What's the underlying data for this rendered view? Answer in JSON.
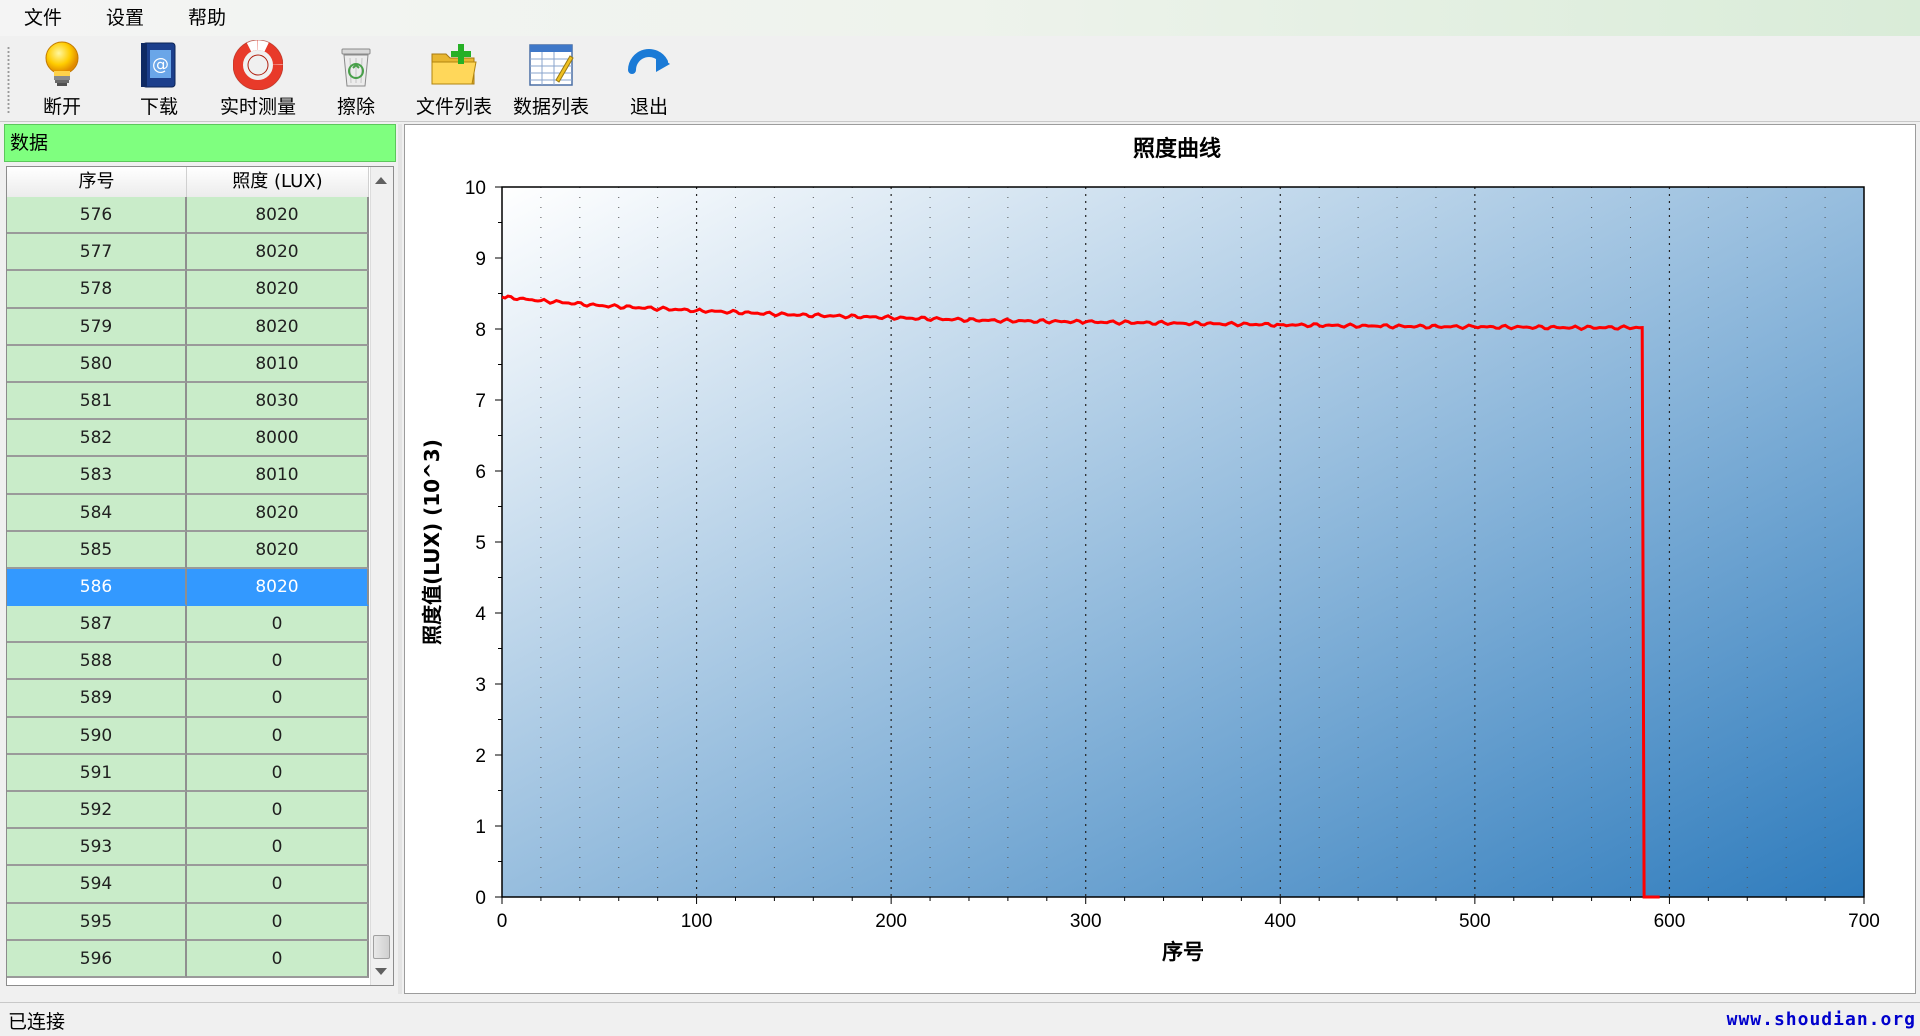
{
  "menu": {
    "items": [
      {
        "label": "文件"
      },
      {
        "label": "设置"
      },
      {
        "label": "帮助"
      }
    ]
  },
  "toolbar": {
    "buttons": [
      {
        "label": "断开",
        "icon": "lightbulb-icon"
      },
      {
        "label": "下载",
        "icon": "address-book-icon"
      },
      {
        "label": "实时测量",
        "icon": "lifebuoy-icon"
      },
      {
        "label": "擦除",
        "icon": "recycle-bin-icon"
      },
      {
        "label": "文件列表",
        "icon": "folder-add-icon"
      },
      {
        "label": "数据列表",
        "icon": "spreadsheet-icon"
      },
      {
        "label": "退出",
        "icon": "undo-arrow-icon"
      }
    ]
  },
  "panel": {
    "title": "数据",
    "columns": [
      "序号",
      "照度 (LUX)"
    ],
    "rows": [
      [
        "576",
        "8020"
      ],
      [
        "577",
        "8020"
      ],
      [
        "578",
        "8020"
      ],
      [
        "579",
        "8020"
      ],
      [
        "580",
        "8010"
      ],
      [
        "581",
        "8030"
      ],
      [
        "582",
        "8000"
      ],
      [
        "583",
        "8010"
      ],
      [
        "584",
        "8020"
      ],
      [
        "585",
        "8020"
      ],
      [
        "586",
        "8020"
      ],
      [
        "587",
        "0"
      ],
      [
        "588",
        "0"
      ],
      [
        "589",
        "0"
      ],
      [
        "590",
        "0"
      ],
      [
        "591",
        "0"
      ],
      [
        "592",
        "0"
      ],
      [
        "593",
        "0"
      ],
      [
        "594",
        "0"
      ],
      [
        "595",
        "0"
      ],
      [
        "596",
        "0"
      ]
    ],
    "selected_row": "586"
  },
  "chart_data": {
    "type": "line",
    "title": "照度曲线",
    "xlabel": "序号",
    "ylabel": "照度值(LUX)  (10^3)",
    "xlim": [
      0,
      700
    ],
    "ylim": [
      0,
      10
    ],
    "xticks": [
      0,
      100,
      200,
      300,
      400,
      500,
      600,
      700
    ],
    "yticks": [
      0,
      1,
      2,
      3,
      4,
      5,
      6,
      7,
      8,
      9,
      10
    ],
    "grid": true,
    "series_color": "#ff0000",
    "series": [
      {
        "x": [
          0,
          20,
          50,
          100,
          150,
          200,
          250,
          300,
          350,
          400,
          450,
          500,
          550,
          586,
          587,
          590,
          595
        ],
        "y": [
          8.45,
          8.4,
          8.33,
          8.26,
          8.2,
          8.16,
          8.12,
          8.1,
          8.08,
          8.06,
          8.04,
          8.03,
          8.02,
          8.02,
          0,
          0,
          0
        ]
      }
    ],
    "background": [
      "#ffffff",
      "#2f7cbd"
    ]
  },
  "status": {
    "text": "已连接",
    "watermark": "www.shoudian.org"
  }
}
